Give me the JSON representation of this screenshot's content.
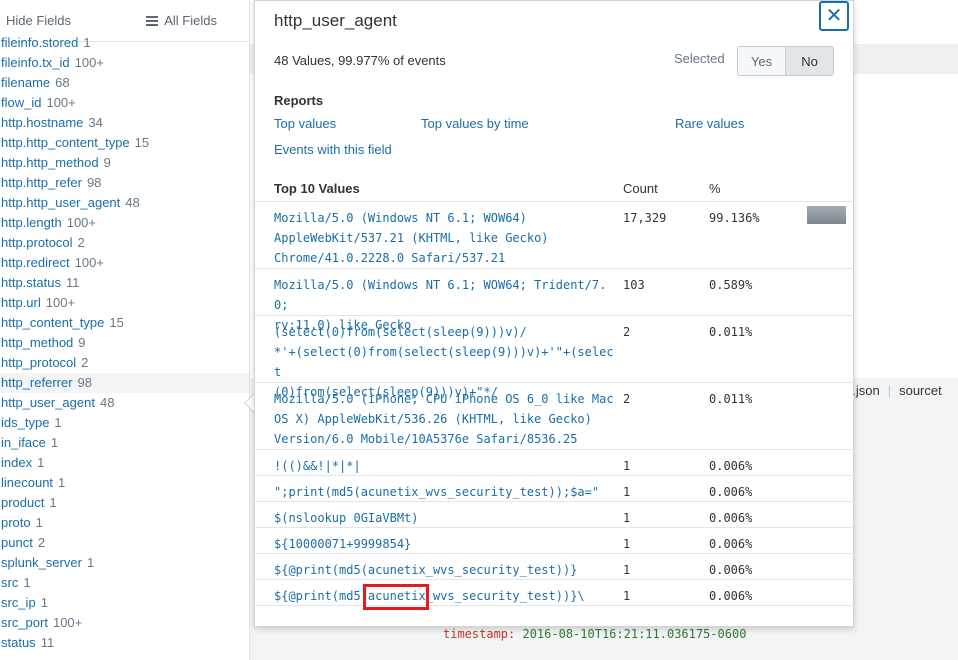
{
  "sidebar": {
    "hide_fields": "Hide Fields",
    "all_fields": "All Fields",
    "fields": [
      {
        "name": "fileinfo.stored",
        "count": "1"
      },
      {
        "name": "fileinfo.tx_id",
        "count": "100+"
      },
      {
        "name": "filename",
        "count": "68"
      },
      {
        "name": "flow_id",
        "count": "100+"
      },
      {
        "name": "http.hostname",
        "count": "34"
      },
      {
        "name": "http.http_content_type",
        "count": "15"
      },
      {
        "name": "http.http_method",
        "count": "9"
      },
      {
        "name": "http.http_refer",
        "count": "98"
      },
      {
        "name": "http.http_user_agent",
        "count": "48"
      },
      {
        "name": "http.length",
        "count": "100+"
      },
      {
        "name": "http.protocol",
        "count": "2"
      },
      {
        "name": "http.redirect",
        "count": "100+"
      },
      {
        "name": "http.status",
        "count": "11"
      },
      {
        "name": "http.url",
        "count": "100+"
      },
      {
        "name": "http_content_type",
        "count": "15"
      },
      {
        "name": "http_method",
        "count": "9"
      },
      {
        "name": "http_protocol",
        "count": "2"
      },
      {
        "name": "http_referrer",
        "count": "98"
      },
      {
        "name": "http_user_agent",
        "count": "48"
      },
      {
        "name": "ids_type",
        "count": "1"
      },
      {
        "name": "in_iface",
        "count": "1"
      },
      {
        "name": "index",
        "count": "1"
      },
      {
        "name": "linecount",
        "count": "1"
      },
      {
        "name": "product",
        "count": "1"
      },
      {
        "name": "proto",
        "count": "1"
      },
      {
        "name": "punct",
        "count": "2"
      },
      {
        "name": "splunk_server",
        "count": "1"
      },
      {
        "name": "src",
        "count": "1"
      },
      {
        "name": "src_ip",
        "count": "1"
      },
      {
        "name": "src_port",
        "count": "100+"
      },
      {
        "name": "status",
        "count": "11"
      }
    ]
  },
  "event": {
    "tail_text": "e.json",
    "tail_field": "sourcet",
    "code_key": "timestamp",
    "code_value": "2016-08-10T16:21:11.036175-0600"
  },
  "popup": {
    "title": "http_user_agent",
    "close_label": "✕",
    "summary": "48 Values, 99.977% of events",
    "selected_label": "Selected",
    "yes": "Yes",
    "no": "No",
    "reports_title": "Reports",
    "reports": {
      "top_values": "Top values",
      "top_values_by_time": "Top values by time",
      "rare_values": "Rare values",
      "events_with_field": "Events with this field"
    },
    "values_header": {
      "title": "Top 10 Values",
      "count": "Count",
      "pct": "%"
    },
    "values": [
      {
        "value": "Mozilla/5.0 (Windows NT 6.1; WOW64)\nAppleWebKit/537.21 (KHTML, like Gecko)\nChrome/41.0.2228.0 Safari/537.21",
        "count": "17,329",
        "pct": "99.136%",
        "fraction": 0.99136
      },
      {
        "value": "Mozilla/5.0 (Windows NT 6.1; WOW64; Trident/7.0;\nrv:11.0) like Gecko",
        "count": "103",
        "pct": "0.589%",
        "fraction": 0.00589
      },
      {
        "value": "(select(0)from(select(sleep(9)))v)/\n*'+(select(0)from(select(sleep(9)))v)+'\"+(select\n(0)from(select(sleep(9)))v)+\"*/",
        "count": "2",
        "pct": "0.011%",
        "fraction": 0.00011
      },
      {
        "value": "Mozilla/5.0 (iPhone; CPU iPhone OS 6_0 like Mac\nOS X) AppleWebKit/536.26 (KHTML, like Gecko)\nVersion/6.0 Mobile/10A5376e Safari/8536.25",
        "count": "2",
        "pct": "0.011%",
        "fraction": 0.00011
      },
      {
        "value": "!(()&&!|*|*|",
        "count": "1",
        "pct": "0.006%",
        "fraction": 6e-05
      },
      {
        "value": "\";print(md5(acunetix_wvs_security_test));$a=\"",
        "count": "1",
        "pct": "0.006%",
        "fraction": 6e-05
      },
      {
        "value": "$(nslookup 0GIaVBMt)",
        "count": "1",
        "pct": "0.006%",
        "fraction": 6e-05
      },
      {
        "value": "${10000071+9999854}",
        "count": "1",
        "pct": "0.006%",
        "fraction": 6e-05
      },
      {
        "value": "${@print(md5(acunetix_wvs_security_test))}",
        "count": "1",
        "pct": "0.006%",
        "fraction": 6e-05
      },
      {
        "value": "${@print(md5(acunetix_wvs_security_test))}\\",
        "count": "1",
        "pct": "0.006%",
        "fraction": 6e-05
      }
    ]
  }
}
